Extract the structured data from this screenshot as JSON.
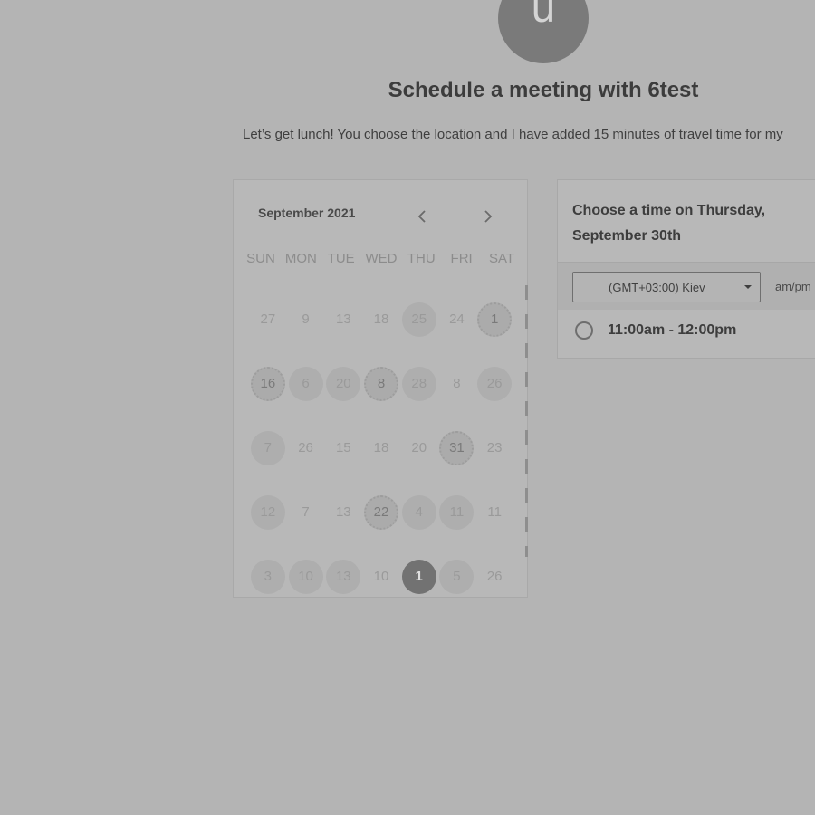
{
  "header": {
    "avatar_letter": "u",
    "title": "Schedule a meeting with 6test",
    "subtitle": "Let’s get lunch! You choose the location and I have added 15 minutes of travel time for my"
  },
  "calendar": {
    "month": "September 2021",
    "weekdays": [
      "SUN",
      "MON",
      "TUE",
      "WED",
      "THU",
      "FRI",
      "SAT"
    ],
    "weeks": [
      [
        {
          "d": "27"
        },
        {
          "d": "9"
        },
        {
          "d": "13"
        },
        {
          "d": "18"
        },
        {
          "d": "25",
          "s": "avail"
        },
        {
          "d": "24"
        },
        {
          "d": "1",
          "s": "dotted"
        }
      ],
      [
        {
          "d": "16",
          "s": "dotted"
        },
        {
          "d": "6",
          "s": "avail"
        },
        {
          "d": "20",
          "s": "avail"
        },
        {
          "d": "8",
          "s": "dotted"
        },
        {
          "d": "28",
          "s": "avail"
        },
        {
          "d": "8"
        },
        {
          "d": "26",
          "s": "avail"
        }
      ],
      [
        {
          "d": "7",
          "s": "avail"
        },
        {
          "d": "26"
        },
        {
          "d": "15"
        },
        {
          "d": "18"
        },
        {
          "d": "20"
        },
        {
          "d": "31",
          "s": "dotted"
        },
        {
          "d": "23"
        }
      ],
      [
        {
          "d": "12",
          "s": "avail"
        },
        {
          "d": "7"
        },
        {
          "d": "13"
        },
        {
          "d": "22",
          "s": "dotted"
        },
        {
          "d": "4",
          "s": "avail"
        },
        {
          "d": "11",
          "s": "avail"
        },
        {
          "d": "11"
        }
      ],
      [
        {
          "d": "3",
          "s": "avail"
        },
        {
          "d": "10",
          "s": "avail"
        },
        {
          "d": "13",
          "s": "avail"
        },
        {
          "d": "10"
        },
        {
          "d": "1",
          "s": "selected"
        },
        {
          "d": "5",
          "s": "avail"
        },
        {
          "d": "26"
        }
      ]
    ]
  },
  "time_panel": {
    "heading": "Choose a time on Thursday, September 30th",
    "timezone": "(GMT+03:00) Kiev",
    "ampm": "am/pm",
    "slots": [
      "11:00am - 12:00pm"
    ]
  }
}
